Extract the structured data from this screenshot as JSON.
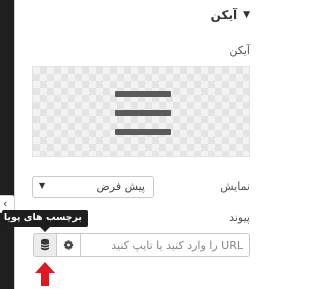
{
  "section": {
    "title": "آیکن",
    "caret": "▼"
  },
  "icon_field": {
    "label": "آیکن",
    "preview_icon": "hamburger-menu-icon"
  },
  "display_field": {
    "label": "نمایش",
    "selected": "پیش فرض",
    "caret": "▼"
  },
  "link_field": {
    "label": "پیوند",
    "placeholder": "URL را وارد کنید یا تایپ کنید"
  },
  "tooltip": {
    "text": "برچسب های پویا"
  },
  "collapse_tab": {
    "glyph": "‹"
  },
  "colors": {
    "sidebar": "#1f1f1f",
    "tooltip": "#1e1e1e",
    "arrow": "#e3171f",
    "preview_bg": "#f3f3f3"
  }
}
